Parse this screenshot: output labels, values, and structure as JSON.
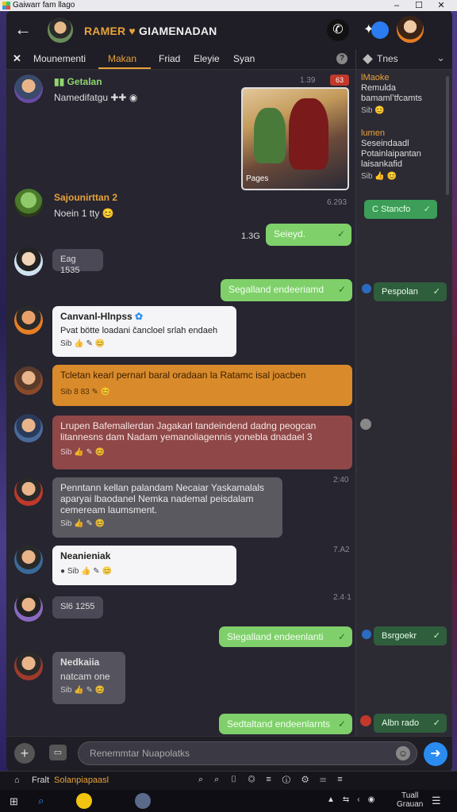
{
  "window": {
    "title": "Gaiwarr fam llago"
  },
  "header": {
    "title_part1": "RAMER",
    "title_part2": "GIAMENADAN"
  },
  "tabs": [
    {
      "label": "Mounementi"
    },
    {
      "label": "Makan"
    },
    {
      "label": "Friad"
    },
    {
      "label": "Eleyie"
    },
    {
      "label": "Syan"
    }
  ],
  "sidebar": {
    "title": "Tnes",
    "cards": [
      {
        "name": "lMaoke",
        "lines": "Remulda\nbamamlʼtfcamts",
        "meta": "Sib"
      },
      {
        "name": "lumen",
        "lines": "Seseindaadl\nPotainlaipantan\nlaisankafid",
        "meta": "Sib"
      }
    ],
    "chips": [
      "C Stancfo",
      "Pespolan",
      "Bsrgoekr",
      "Albn rado"
    ]
  },
  "messages": [
    {
      "name": "Getalan",
      "text": "Namedifatgu",
      "time": "1.39",
      "badge": "63"
    },
    {
      "image_caption": "Pages"
    },
    {
      "name": "Sajounirttan 2",
      "text": "Noein 1 tty",
      "time": "6.293"
    },
    {
      "text": "Seieyd.",
      "time": "1.3G"
    },
    {
      "text": "Eag 1535"
    },
    {
      "text": "Segalland endeeriamd"
    },
    {
      "name": "Canvanl-Hlnpss",
      "text": "Pvat bötte  loadani čancloel srlah endaeh",
      "meta": "Sib"
    },
    {
      "text": "Tcletan kearl pernarl baral oradaan la Ratamc isal joacben",
      "meta": "Sib  8 83"
    },
    {
      "text": "Lrupen Bafemallerdan Jagakarl tandeindend dadng peogcan litannesns dam  Nadam yemanoliagennis yonebla dnadael 3",
      "meta": "Sib"
    },
    {
      "text": "Penntann kellan palandam Necaiar Yaskamalals aparyai lbaodanel Nemka nademal peisdalam cemeream laumsment.",
      "meta": "Sib",
      "time": "2:40"
    },
    {
      "name": "Neanieniak",
      "text": "",
      "meta": "Sib",
      "time": "7.A2"
    },
    {
      "text": "Sl6 1255",
      "time": "2.4·1"
    },
    {
      "text": "Slegalland endeenlanti"
    },
    {
      "name": "Nedkaiia",
      "text": "natcam one",
      "meta": "Sib"
    },
    {
      "text": "Sedtaltand endeenlarnts"
    }
  ],
  "input": {
    "placeholder": "Renemmtar Nuapolatks"
  },
  "status": {
    "left": "Fralt",
    "label": "Solanpiapaasl"
  },
  "taskbar": {
    "clock_line1": "Tuall",
    "clock_line2": "Grauan"
  }
}
